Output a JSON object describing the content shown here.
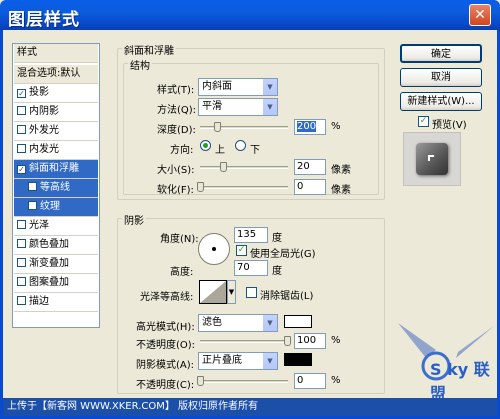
{
  "window": {
    "title": "图层样式",
    "close": "✕"
  },
  "sidebar": {
    "header": "样式",
    "blend": "混合选项:默认",
    "items": [
      {
        "label": "投影",
        "checked": true
      },
      {
        "label": "内阴影",
        "checked": false
      },
      {
        "label": "外发光",
        "checked": false
      },
      {
        "label": "内发光",
        "checked": false
      },
      {
        "label": "斜面和浮雕",
        "checked": true
      },
      {
        "label": "等高线",
        "checked": false
      },
      {
        "label": "纹理",
        "checked": false
      },
      {
        "label": "光泽",
        "checked": false
      },
      {
        "label": "颜色叠加",
        "checked": false
      },
      {
        "label": "渐变叠加",
        "checked": false
      },
      {
        "label": "图案叠加",
        "checked": false
      },
      {
        "label": "描边",
        "checked": false
      }
    ]
  },
  "bevel": {
    "section_title": "斜面和浮雕",
    "structure_title": "结构",
    "style_label": "样式(T):",
    "style_value": "内斜面",
    "method_label": "方法(Q):",
    "method_value": "平滑",
    "depth_label": "深度(D):",
    "depth_value": "200",
    "depth_unit": "%",
    "direction_label": "方向:",
    "dir_up": "上",
    "dir_down": "下",
    "size_label": "大小(S):",
    "size_value": "20",
    "size_unit": "像素",
    "soften_label": "软化(F):",
    "soften_value": "0",
    "soften_unit": "像素"
  },
  "shading": {
    "title": "阴影",
    "angle_label": "角度(N):",
    "angle_value": "135",
    "angle_unit": "度",
    "global_light": "使用全局光(G)",
    "altitude_label": "高度:",
    "altitude_value": "70",
    "altitude_unit": "度",
    "gloss_label": "光泽等高线:",
    "antialias": "消除锯齿(L)",
    "highlight_label": "高光模式(H):",
    "highlight_value": "滤色",
    "highlight_color": "#ffffff",
    "op1_label": "不透明度(O):",
    "op1_value": "100",
    "op_unit": "%",
    "shadow_label": "阴影模式(A):",
    "shadow_value": "正片叠底",
    "shadow_color": "#000000",
    "op2_label": "不透明度(C):",
    "op2_value": "0"
  },
  "buttons": {
    "ok": "确定",
    "cancel": "取消",
    "new_style": "新建样式(W)...",
    "preview": "预览(V)"
  },
  "footer": "上传于【新客网 WWW.XKER.COM】 版权归原作者所有",
  "watermark": "S ky 联盟"
}
